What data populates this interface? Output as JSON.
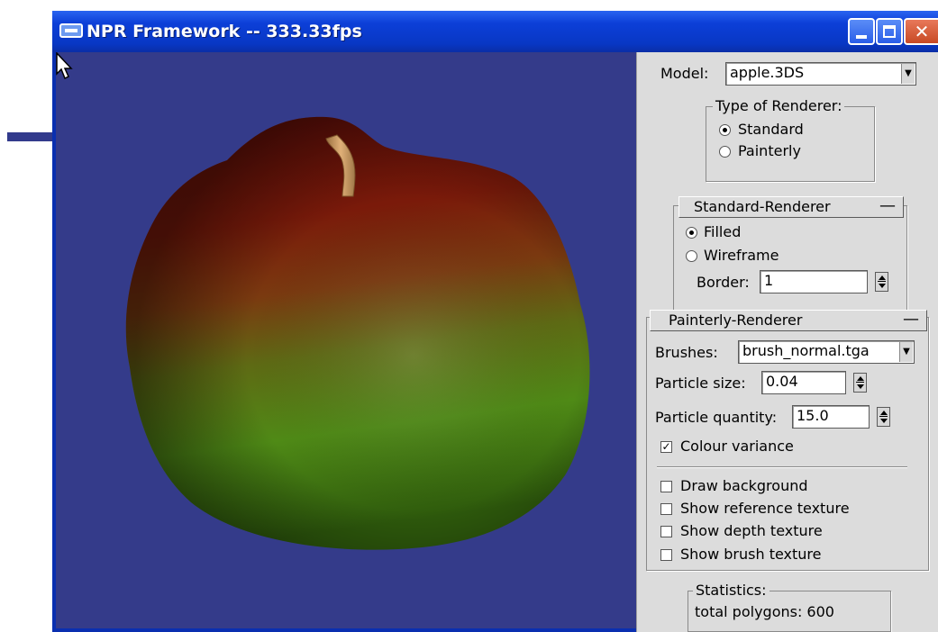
{
  "window": {
    "title": "NPR Framework -- 333.33fps"
  },
  "model": {
    "label": "Model:",
    "value": "apple.3DS"
  },
  "renderer_type": {
    "title": "Type of Renderer:",
    "options": [
      {
        "label": "Standard",
        "selected": true
      },
      {
        "label": "Painterly",
        "selected": false
      }
    ]
  },
  "standard_renderer": {
    "title": "Standard-Renderer",
    "collapse": "—",
    "options": [
      {
        "label": "Filled",
        "selected": true
      },
      {
        "label": "Wireframe",
        "selected": false
      }
    ],
    "border_label": "Border:",
    "border_value": "1"
  },
  "painterly_renderer": {
    "title": "Painterly-Renderer",
    "collapse": "—",
    "brushes_label": "Brushes:",
    "brushes_value": "brush_normal.tga",
    "particle_size_label": "Particle size:",
    "particle_size_value": "0.04",
    "particle_quantity_label": "Particle quantity:",
    "particle_quantity_value": "15.0",
    "checkboxes": [
      {
        "label": "Colour variance",
        "checked": true
      },
      {
        "label": "Draw background",
        "checked": false
      },
      {
        "label": "Show reference texture",
        "checked": false
      },
      {
        "label": "Show depth texture",
        "checked": false
      },
      {
        "label": "Show brush texture",
        "checked": false
      }
    ]
  },
  "statistics": {
    "title": "Statistics:",
    "text": "total polygons: 600"
  },
  "icons": {
    "window": "app-window-icon",
    "minimize": "minimize-icon",
    "maximize": "maximize-icon",
    "close": "close-icon",
    "cursor": "mouse-pointer-icon"
  },
  "colors": {
    "titlebar": "#0c3fd8",
    "viewport_bg": "#343b8a",
    "panel_bg": "#dcdcdc",
    "close_button": "#d2522e"
  }
}
